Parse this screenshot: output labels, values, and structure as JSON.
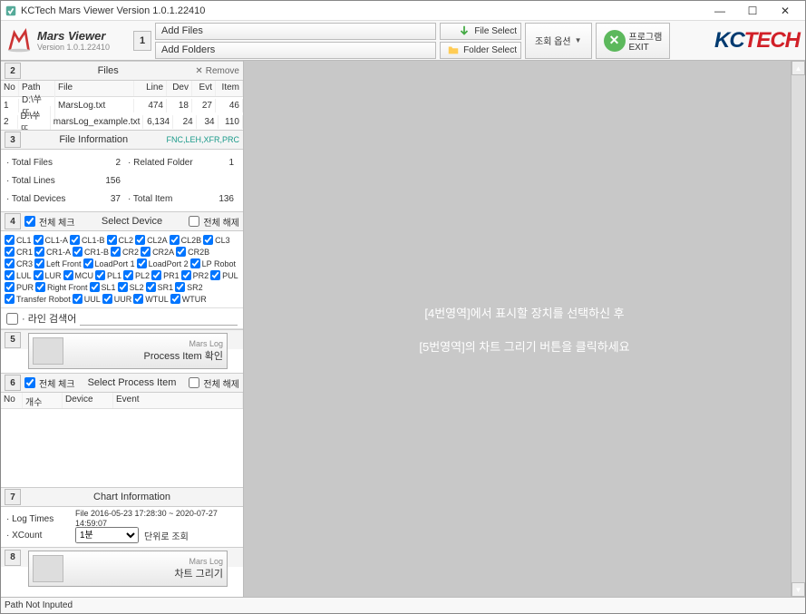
{
  "window": {
    "title": "KCTech Mars Viewer Version 1.0.1.22410"
  },
  "brand": {
    "name": "Mars Viewer",
    "version": "Version 1.0.1.22410"
  },
  "toolbar": {
    "num1": "1",
    "add_files": "Add Files",
    "add_folders": "Add Folders",
    "file_select": "File Select",
    "folder_select": "Folder Select",
    "options": "조회 옵션",
    "exit_top": "프로그램",
    "exit_bottom": "EXIT"
  },
  "logo": {
    "kc": "KC",
    "tech": "TECH"
  },
  "sec2": {
    "num": "2",
    "title": "Files",
    "remove": "Remove"
  },
  "files_headers": {
    "no": "No",
    "path": "Path",
    "file": "File",
    "line": "Line",
    "dev": "Dev",
    "evt": "Evt",
    "item": "Item"
  },
  "files_rows": [
    {
      "no": "1",
      "path": "D:\\쑤뜨…",
      "file": "MarsLog.txt",
      "line": "474",
      "dev": "18",
      "evt": "27",
      "item": "46"
    },
    {
      "no": "2",
      "path": "D:\\쑤뜨…",
      "file": "marsLog_example.txt",
      "line": "6,134",
      "dev": "24",
      "evt": "34",
      "item": "110"
    }
  ],
  "sec3": {
    "num": "3",
    "title": "File Information",
    "tags": "FNC,LEH,XFR,PRC"
  },
  "file_info": {
    "total_files_lbl": "· Total Files",
    "total_files": "2",
    "related_folder_lbl": "· Related Folder",
    "related_folder": "1",
    "total_lines_lbl": "· Total Lines",
    "total_lines": "156",
    "total_devices_lbl": "· Total Devices",
    "total_devices": "37",
    "total_item_lbl": "· Total Item",
    "total_item": "136"
  },
  "sec4": {
    "num": "4",
    "check_all": "전체 체크",
    "title": "Select Device",
    "uncheck_all": "전체 해제"
  },
  "devices": [
    "CL1",
    "CL1-A",
    "CL1-B",
    "CL2",
    "CL2A",
    "CL2B",
    "CL3",
    "CR1",
    "CR1-A",
    "CR1-B",
    "CR2",
    "CR2A",
    "CR2B",
    "CR3",
    "Left Front",
    "LoadPort 1",
    "LoadPort 2",
    "LP Robot",
    "LUL",
    "LUR",
    "MCU",
    "PL1",
    "PL2",
    "PR1",
    "PR2",
    "PUL",
    "PUR",
    "Right Front",
    "SL1",
    "SL2",
    "SR1",
    "SR2",
    "Transfer Robot",
    "UUL",
    "UUR",
    "WTUL",
    "WTUR"
  ],
  "search": {
    "label": "· 라인 검색어"
  },
  "sec5": {
    "num": "5",
    "sub": "Mars Log",
    "label": "Process Item 확인"
  },
  "sec6": {
    "num": "6",
    "check_all": "전체 체크",
    "title": "Select Process Item",
    "uncheck_all": "전체 해제"
  },
  "proc_headers": {
    "no": "No",
    "cnt": "개수",
    "dev": "Device",
    "evt": "Event"
  },
  "sec7": {
    "num": "7",
    "title": "Chart Information"
  },
  "chart_info": {
    "log_times_lbl": "· Log Times",
    "log_times": "File 2016-05-23 17:28:30 ~ 2020-07-27 14:59:07",
    "xcount_lbl": "· XCount",
    "xcount_sel": "1분",
    "xcount_unit": "단위로 조회"
  },
  "sec8": {
    "num": "8",
    "sub": "Mars Log",
    "label": "차트 그리기"
  },
  "right_panel": {
    "line1": "[4번영역]에서 표시할 장치를 선택하신 후",
    "line2": "[5번영역]의 차트 그리기 버튼을 클릭하세요"
  },
  "status": "Path Not Inputed"
}
